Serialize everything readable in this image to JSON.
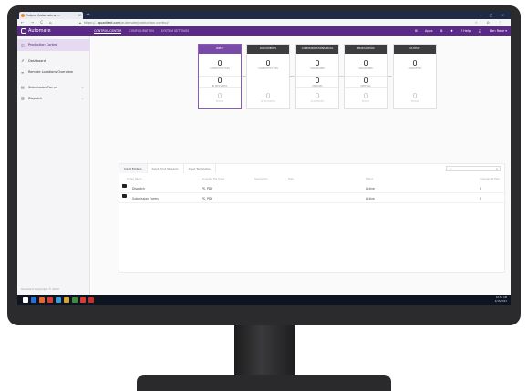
{
  "browser": {
    "tab_title": "Output Automate ▸ …",
    "url_prefix": "https://…",
    "url_host": "quadient.com",
    "url_path": "/automate/production-control/",
    "nav": "← → C ⌂",
    "right_icons": "☆ ⊘ ⋮"
  },
  "header": {
    "logo_text": "Automate",
    "menu": [
      {
        "label": "CONTROL CENTER",
        "active": true
      },
      {
        "label": "CONFIGURATION",
        "active": false
      },
      {
        "label": "SYSTEM SETTINGS",
        "active": false
      }
    ],
    "apps_label": "Apps",
    "help_label": "? Help",
    "user_label": "Ben Rose ▾"
  },
  "sidebar": {
    "items": [
      {
        "label": "Production Control",
        "icon": "dashboard-icon",
        "glyph": "◫",
        "selected": true
      },
      {
        "label": "Dashboard",
        "icon": "chart-icon",
        "glyph": "⇗",
        "selected": false
      },
      {
        "label": "Remote Locations Overview",
        "icon": "locations-icon",
        "glyph": "≡",
        "selected": false
      },
      {
        "label": "Submission Forms",
        "icon": "forms-icon",
        "glyph": "▤",
        "selected": false
      },
      {
        "label": "Dispatch",
        "icon": "dispatch-icon",
        "glyph": "▥",
        "selected": false
      }
    ],
    "footer": "Quadient Copyright © 2022"
  },
  "pipeline": [
    {
      "title": "INPUT",
      "active": true,
      "cells": [
        {
          "value": "0",
          "label": "COMPLETED FILES",
          "dim": false
        },
        {
          "value": "0",
          "label": "IN PROGRESS",
          "dim": false
        },
        {
          "value": "0",
          "label": "ERROR",
          "dim": true
        }
      ]
    },
    {
      "title": "DOCUMENTS",
      "active": false,
      "cells": [
        {
          "value": "0",
          "label": "COMPLETED FILES",
          "dim": false
        },
        {
          "value": "0",
          "label": "IN PROGRESS",
          "dim": true
        }
      ]
    },
    {
      "title": "COMMUNICATIONS POOL",
      "active": false,
      "cells": [
        {
          "value": "0",
          "label": "UNASSIGNED",
          "dim": false
        },
        {
          "value": "0",
          "label": "PENDING",
          "dim": false
        },
        {
          "value": "0",
          "label": "SUSPENDED",
          "dim": true
        }
      ]
    },
    {
      "title": "PRODUCTION",
      "active": false,
      "cells": [
        {
          "value": "0",
          "label": "UNASSIGNED",
          "dim": false
        },
        {
          "value": "0",
          "label": "PENDING",
          "dim": false
        },
        {
          "value": "0",
          "label": "ERROR",
          "dim": true
        }
      ]
    },
    {
      "title": "OUTPUT",
      "active": false,
      "cells": [
        {
          "value": "0",
          "label": "COMPLETED",
          "dim": false
        },
        {
          "value": "0",
          "label": "ERROR",
          "dim": true
        }
      ]
    }
  ],
  "panel": {
    "tabs": [
      {
        "label": "Input Folders",
        "active": true
      },
      {
        "label": "Input Print Streams",
        "active": false
      },
      {
        "label": "Input Templates",
        "active": false
      }
    ],
    "search_placeholder": "",
    "columns": [
      "Folder Name",
      "Accepted File Types",
      "Description",
      "Tags",
      "Status",
      "Unassigned Files"
    ],
    "rows": [
      {
        "name": "Dispatch",
        "types": "PS, PDF",
        "description": "",
        "tags": "",
        "status": "Active",
        "unassigned": "0"
      },
      {
        "name": "Submission Forms",
        "types": "PS, PDF",
        "description": "",
        "tags": "",
        "status": "Active",
        "unassigned": "0"
      }
    ]
  },
  "taskbar": {
    "time": "10:54 AM",
    "date": "4/15/2022",
    "icon_colors": [
      "#ffffff",
      "#2b6fd6",
      "#e8692e",
      "#d43f3a",
      "#33a0d8",
      "#d9a43a",
      "#3c8d3c",
      "#d43f3a",
      "#c9302c"
    ]
  }
}
